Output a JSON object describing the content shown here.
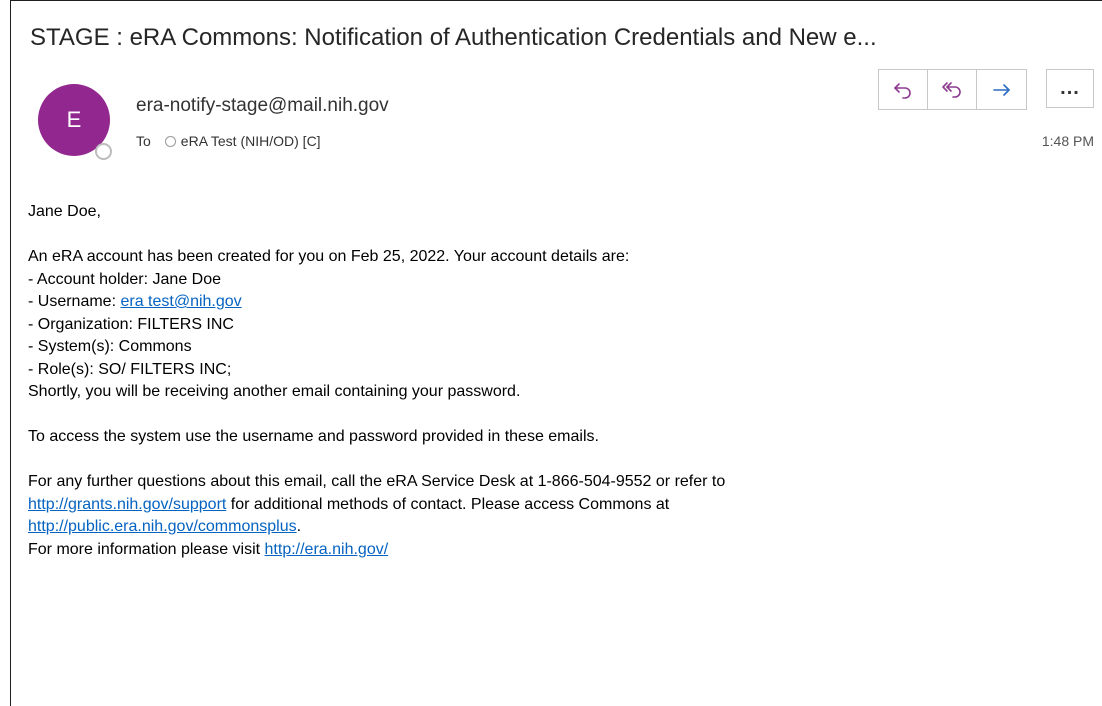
{
  "header": {
    "subject": "STAGE : eRA Commons: Notification of Authentication Credentials and New e...",
    "sender_initial": "E",
    "sender_email": "era-notify-stage@mail.nih.gov",
    "to_label": "To",
    "recipient": "eRA Test  (NIH/OD) [C]",
    "time": "1:48 PM",
    "avatar_color": "#92278f",
    "accent_color": "#8b3a8f"
  },
  "actions": {
    "reply_icon": "reply-icon",
    "reply_all_icon": "reply-all-icon",
    "forward_icon": "forward-icon",
    "more_label": "..."
  },
  "body": {
    "greeting": "Jane Doe,",
    "intro": "An eRA account has been created for you on Feb 25, 2022. Your account details are:",
    "account_holder": "- Account holder: Jane Doe",
    "username_prefix": "- Username: ",
    "username_link": "era test@nih.gov",
    "organization": "- Organization: FILTERS INC",
    "systems": "- System(s): Commons",
    "roles": "- Role(s): SO/ FILTERS INC;",
    "shortly": "Shortly, you will be receiving another email containing your password.",
    "access": "To access the system use the username and password provided in these emails.",
    "questions": "For any further questions about this email, call the eRA Service Desk at 1-866-504-9552 or refer to",
    "support_link": "http://grants.nih.gov/support",
    "support_suffix": " for additional methods of contact. Please access Commons at",
    "commons_link": "http://public.era.nih.gov/commonsplus",
    "commons_suffix": ".",
    "more_info_prefix": "For more information please visit ",
    "era_link": "http://era.nih.gov/"
  }
}
